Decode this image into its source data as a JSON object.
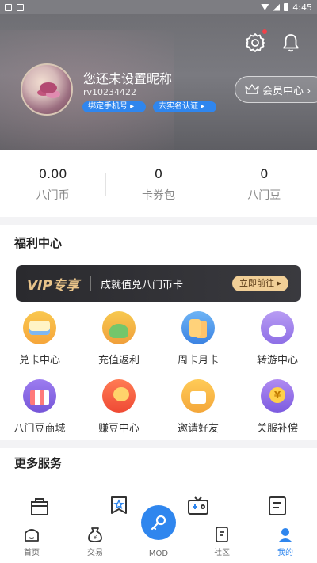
{
  "status_bar": {
    "time": "4:45"
  },
  "header": {
    "nickname": "您还未设置昵称",
    "user_id": "rv10234422",
    "bind_phone": "绑定手机号 ▸",
    "real_name": "去实名认证 ▸",
    "member_center": "会员中心 ›"
  },
  "stats": [
    {
      "value": "0.00",
      "label": "八门币"
    },
    {
      "value": "0",
      "label": "卡券包"
    },
    {
      "value": "0",
      "label": "八门豆"
    }
  ],
  "welfare": {
    "title": "福利中心",
    "vip_banner": {
      "tag": "VIP专享",
      "text": "成就值兑八门币卡",
      "button": "立即前往 ▸"
    },
    "items": [
      {
        "label": "兑卡中心",
        "icon": "card-exchange-icon"
      },
      {
        "label": "充值返利",
        "icon": "recharge-rebate-icon"
      },
      {
        "label": "周卡月卡",
        "icon": "weekly-card-icon"
      },
      {
        "label": "转游中心",
        "icon": "game-transfer-icon"
      },
      {
        "label": "八门豆商城",
        "icon": "bean-mall-icon"
      },
      {
        "label": "赚豆中心",
        "icon": "earn-beans-icon"
      },
      {
        "label": "邀请好友",
        "icon": "invite-friends-icon"
      },
      {
        "label": "关服补偿",
        "icon": "compensation-icon"
      }
    ]
  },
  "more_services": {
    "title": "更多服务"
  },
  "tabbar": [
    {
      "label": "首页"
    },
    {
      "label": "交易"
    },
    {
      "label": "MOD"
    },
    {
      "label": "社区"
    },
    {
      "label": "我的"
    }
  ],
  "colors": {
    "accent": "#2f86ee",
    "vip_gold": "#e9c48a",
    "badge_red": "#f0424a"
  }
}
